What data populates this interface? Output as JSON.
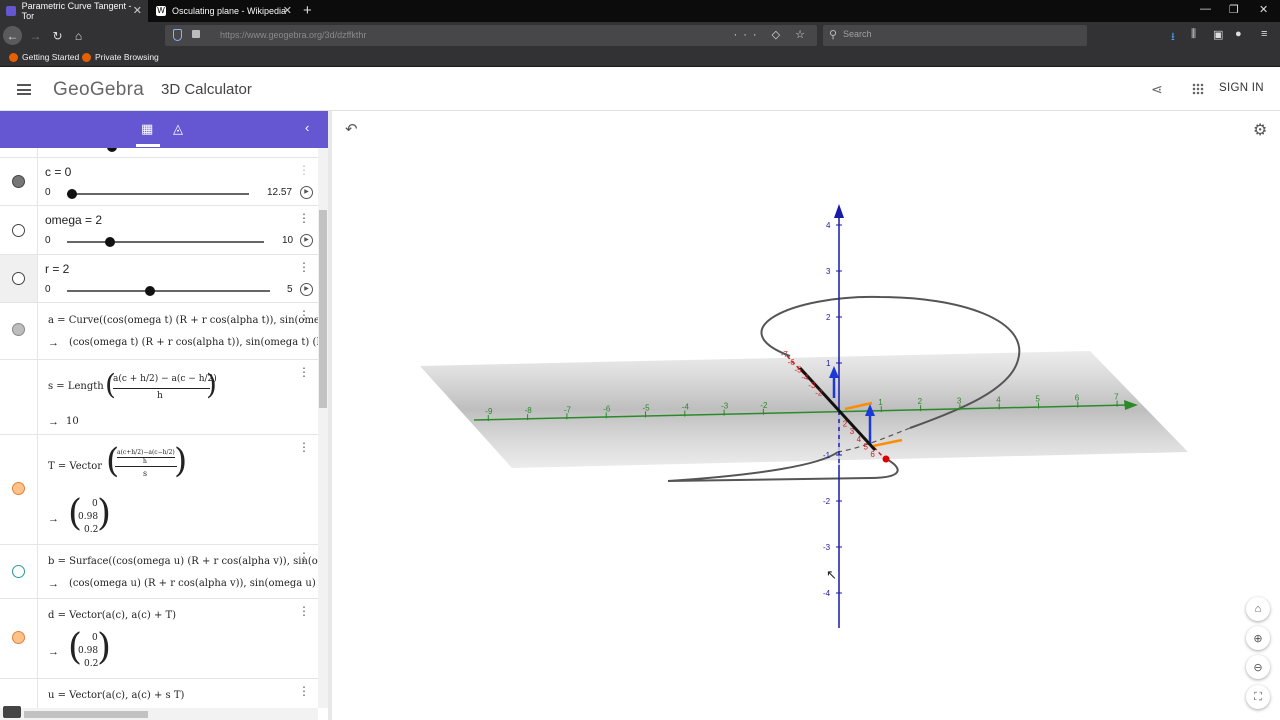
{
  "browser": {
    "tabs": [
      {
        "title": "Parametric Curve Tangent - Tor",
        "active": true
      },
      {
        "title": "Osculating plane - Wikipedia",
        "active": false
      }
    ],
    "url": "https://www.geogebra.org/3d/dzffkthr",
    "search_placeholder": "Search",
    "bookmarks": [
      "Getting Started",
      "Private Browsing"
    ]
  },
  "app": {
    "logo": "GeoGebra",
    "title": "3D Calculator",
    "signin": "SIGN IN"
  },
  "algebra": {
    "sliders": [
      {
        "def": "c = 0",
        "min": "0",
        "max": "12.57",
        "value_fraction": 0.0
      },
      {
        "def": "omega = 2",
        "min": "0",
        "max": "10",
        "value_fraction": 0.2
      },
      {
        "def": "r = 2",
        "min": "0",
        "max": "5",
        "value_fraction": 0.4
      }
    ],
    "a_line1": "a  =  Curve((cos(omega t) (R + r  cos(alpha t)), sin(omeg",
    "a_line2": "(cos(omega t) (R + r  cos(alpha t)), sin(omega t) (R",
    "s_label": "s  =  Length",
    "s_num": "a(c + h/2) − a(c − h/2)",
    "s_den": "h",
    "s_value": "10",
    "T_label": "T  =  Vector",
    "T_num": "a(c+h/2)−a(c−h/2)",
    "T_den1": "h",
    "T_den2": "s",
    "T_vec": [
      "0",
      "0.98",
      "0.2"
    ],
    "b_line1": "b  =  Surface((cos(omega u) (R + r  cos(alpha v)), sin(om",
    "b_line2": "(cos(omega u) (R + r  cos(alpha v)), sin(omega u) (R",
    "d_line": "d  =  Vector(a(c), a(c) + T)",
    "d_vec": [
      "0",
      "0.98",
      "0.2"
    ],
    "u_line": "u  =  Vector(a(c), a(c) + s T)"
  },
  "axes3d": {
    "z_ticks": [
      "4",
      "3",
      "2",
      "1",
      "-1",
      "-2",
      "-3",
      "-4"
    ],
    "y_ticks": [
      "-9",
      "-8",
      "-7",
      "-6",
      "-5",
      "-4",
      "-3",
      "-2",
      "1",
      "2",
      "3",
      "4",
      "5",
      "6",
      "7"
    ],
    "x_ticks": [
      "-7",
      "-6",
      "-5",
      "-4",
      "-3",
      "-2",
      "2",
      "3",
      "4",
      "5",
      "6"
    ],
    "colors": {
      "z_axis": "#1a1aa8",
      "y_axis": "#2a8a2a",
      "x_axis": "#c82020",
      "vector": "#ff8c00"
    }
  }
}
